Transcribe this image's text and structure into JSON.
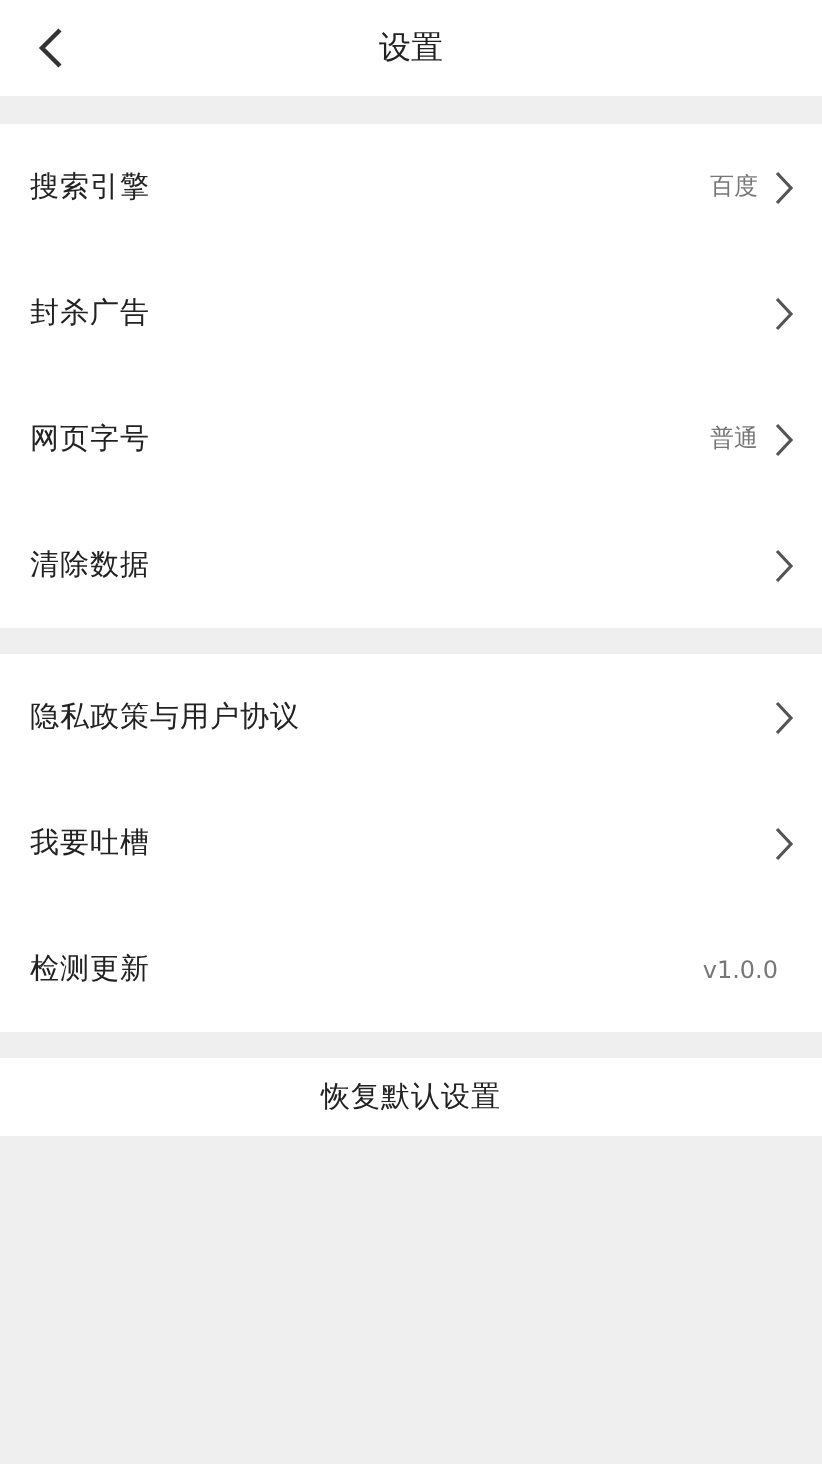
{
  "header": {
    "title": "设置"
  },
  "groups": [
    {
      "rows": [
        {
          "label": "搜索引擎",
          "value": "百度",
          "chevron": true
        },
        {
          "label": "封杀广告",
          "chevron": true
        },
        {
          "label": "网页字号",
          "value": "普通",
          "chevron": true
        },
        {
          "label": "清除数据",
          "chevron": true
        }
      ]
    },
    {
      "rows": [
        {
          "label": "隐私政策与用户协议",
          "chevron": true
        },
        {
          "label": "我要吐槽",
          "chevron": true
        },
        {
          "label": "检测更新",
          "value": "v1.0.0",
          "chevron": false
        }
      ]
    }
  ],
  "reset_button": "恢复默认设置"
}
